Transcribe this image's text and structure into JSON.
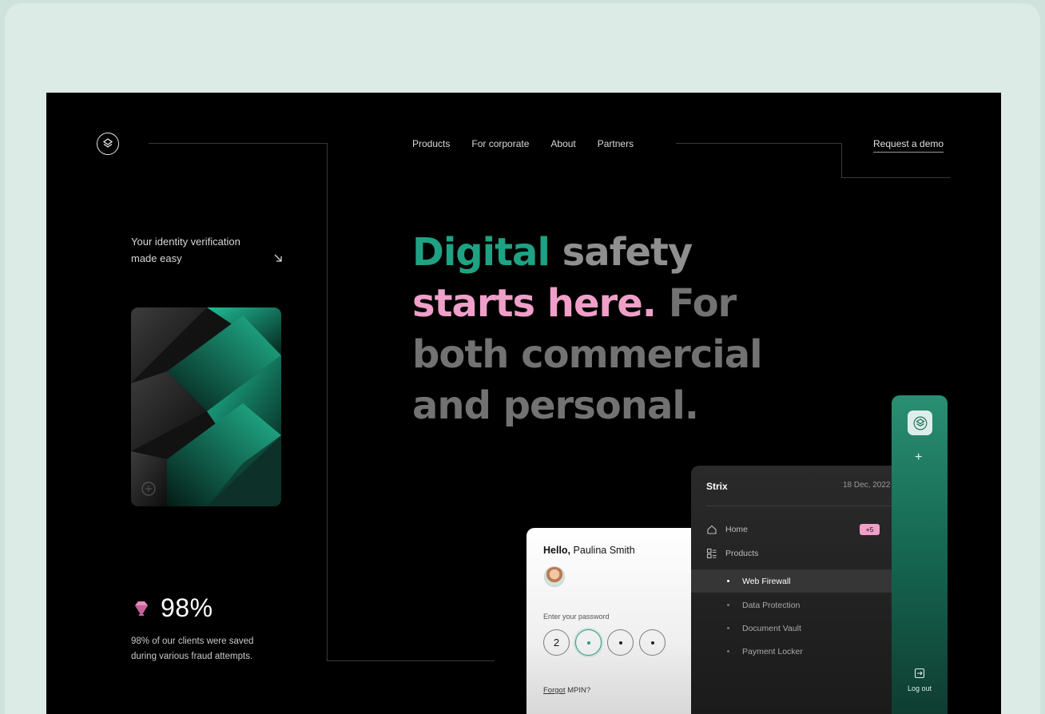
{
  "nav": {
    "items": [
      "Products",
      "For corporate",
      "About",
      "Partners"
    ],
    "cta": "Request a demo"
  },
  "hero": {
    "tagline_line1": "Your identity verification",
    "tagline_line2": "made easy",
    "headline_green": "Digital",
    "headline_after_green": "safety",
    "headline_pink": "starts here.",
    "headline_after_pink": "For",
    "headline_line3": "both commercial",
    "headline_line4": "and personal."
  },
  "stat": {
    "value": "98%",
    "desc_line1": "98% of our clients were saved",
    "desc_line2": "during various fraud attempts."
  },
  "login": {
    "greeting_bold": "Hello,",
    "greeting_name": "Paulina Smith",
    "password_label": "Enter your password",
    "pin_first": "2",
    "forgot_link": "Forgot",
    "forgot_rest": "MPIN?"
  },
  "dashboard": {
    "brand": "Strix",
    "date": "18 Dec, 2022",
    "menu": {
      "home": "Home",
      "home_badge": "+5",
      "products": "Products",
      "sub": [
        "Web Firewall",
        "Data Protection",
        "Document Vault",
        "Payment Locker"
      ]
    }
  },
  "rail": {
    "logout": "Log out"
  },
  "colors": {
    "accent_green": "#1fa283",
    "accent_pink": "#ef9fc8",
    "page_bg": "#dcebe5",
    "site_bg": "#000000"
  }
}
